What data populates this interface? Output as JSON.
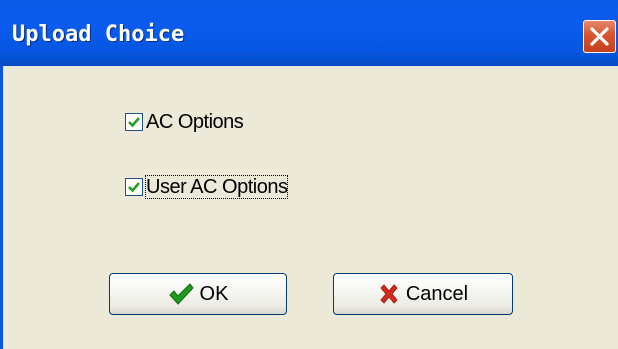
{
  "window": {
    "title": "Upload Choice"
  },
  "options": [
    {
      "label": "AC Options",
      "checked": true
    },
    {
      "label": "User AC Options",
      "checked": true
    }
  ],
  "buttons": {
    "ok_label": "OK",
    "cancel_label": "Cancel"
  },
  "colors": {
    "titlebar": "#0b5bee",
    "dialog_bg": "#ece9d8",
    "close_button": "#d8532f",
    "check_mark": "#21a121",
    "cancel_mark": "#d62a1a"
  }
}
